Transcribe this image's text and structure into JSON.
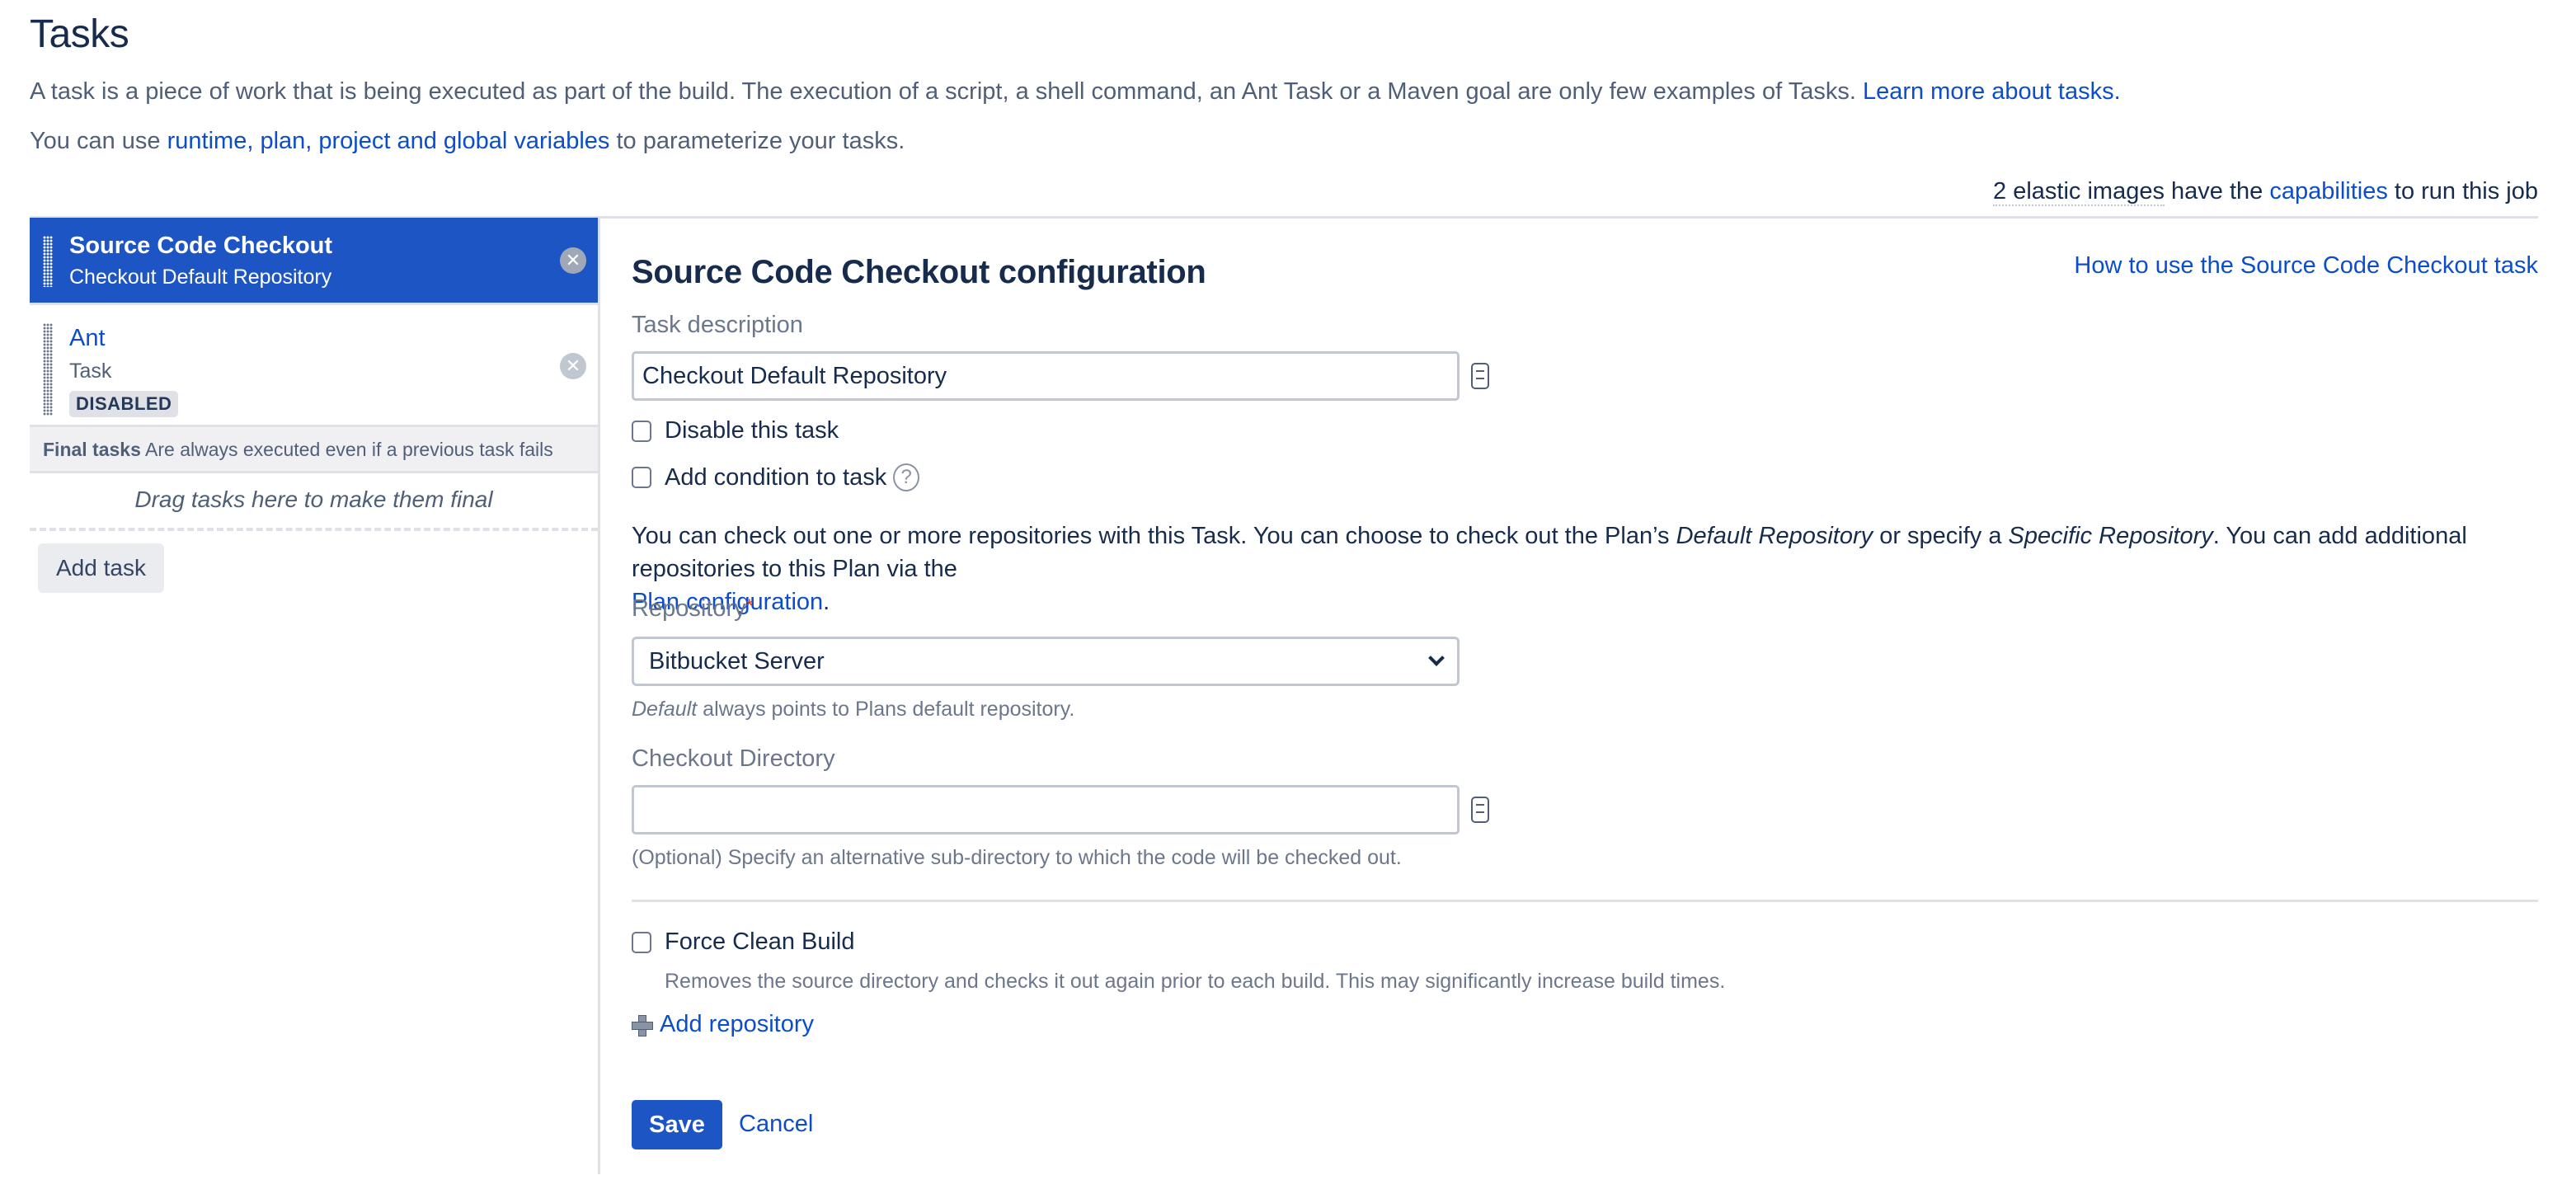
{
  "page": {
    "title": "Tasks",
    "intro_text": "A task is a piece of work that is being executed as part of the build. The execution of a script, a shell command, an Ant Task or a Maven goal are only few examples of Tasks. ",
    "intro_link": "Learn more about tasks.",
    "variables_prefix": "You can use ",
    "variables_link": "runtime, plan, project and global variables",
    "variables_suffix": " to parameterize your tasks.",
    "capabilities_count": "2 elastic images",
    "capabilities_mid": " have the ",
    "capabilities_link": "capabilities",
    "capabilities_suffix": " to run this job"
  },
  "task_list": {
    "tasks": [
      {
        "name": "Source Code Checkout",
        "subtitle": "Checkout Default Repository",
        "selected": true,
        "remove_icon": "close-circle-icon"
      },
      {
        "name": "Ant",
        "subtitle": "Task",
        "badge": "DISABLED",
        "selected": false,
        "remove_icon": "close-circle-icon"
      }
    ],
    "final_tasks_label": "Final tasks",
    "final_tasks_desc": "Are always executed even if a previous task fails",
    "final_dropzone": "Drag tasks here to make them final",
    "add_task_label": "Add task"
  },
  "config": {
    "title": "Source Code Checkout configuration",
    "help_link": "How to use the Source Code Checkout task",
    "task_description_label": "Task description",
    "task_description_value": "Checkout Default Repository",
    "disable_task_label": "Disable this task",
    "disable_task_checked": false,
    "add_condition_label": "Add condition to task",
    "add_condition_checked": false,
    "repo_info_1": "You can check out one or more repositories with this Task. You can choose to check out the Plan’s ",
    "repo_info_default": "Default Repository",
    "repo_info_2": " or specify a ",
    "repo_info_specific": "Specific Repository",
    "repo_info_3": ". You can add additional repositories to this Plan via the ",
    "repo_info_link": "Plan configuration",
    "repo_info_4": ".",
    "repository_label": "Repository",
    "repository_required": "*",
    "repository_value": "Bitbucket Server",
    "repository_help_em": "Default",
    "repository_help": " always points to Plans default repository.",
    "checkout_dir_label": "Checkout Directory",
    "checkout_dir_value": "",
    "checkout_dir_help": "(Optional) Specify an alternative sub-directory to which the code will be checked out.",
    "force_clean_label": "Force Clean Build",
    "force_clean_checked": false,
    "force_clean_help": "Removes the source directory and checks it out again prior to each build. This may significantly increase build times.",
    "add_repository_label": "Add repository",
    "save_label": "Save",
    "cancel_label": "Cancel"
  },
  "colors": {
    "accent": "#1d55c4",
    "link": "#0c4ec9",
    "text": "#172b4d",
    "muted": "#6b778c",
    "border": "#dfe1e6",
    "required": "#de350b"
  }
}
